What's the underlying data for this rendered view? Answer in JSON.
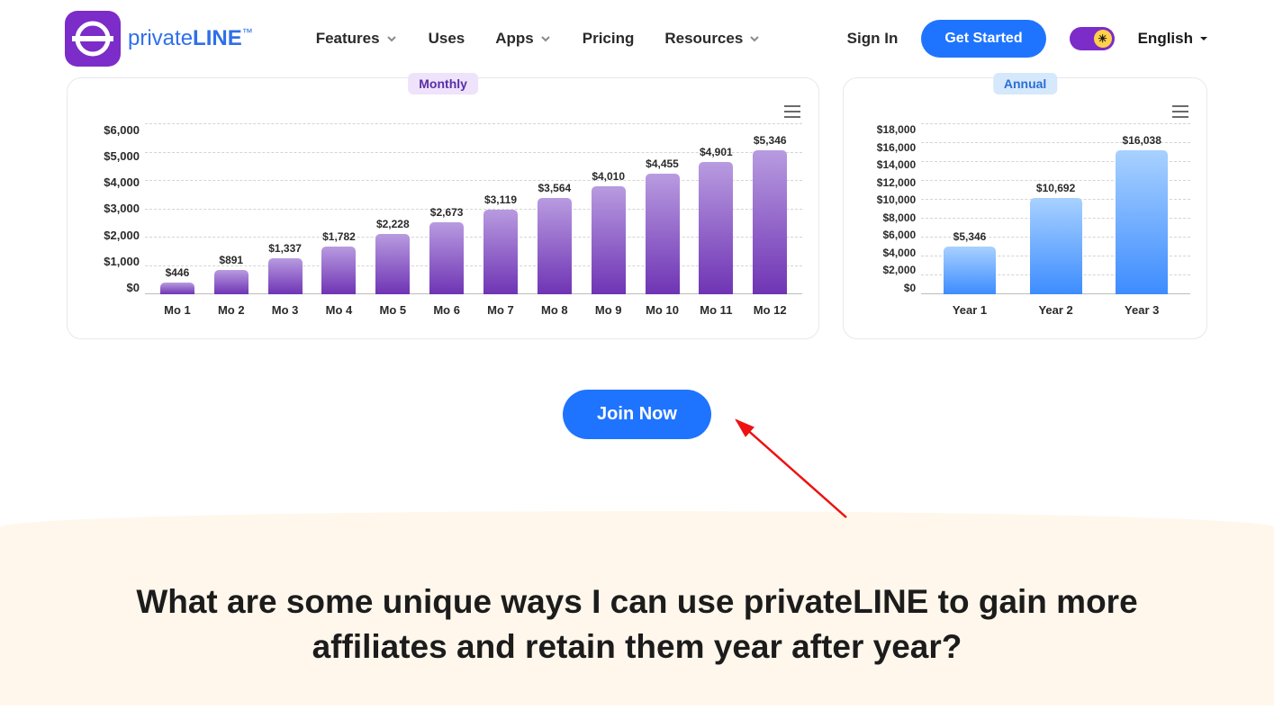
{
  "brand": {
    "private": "private",
    "line": "LINE",
    "tm": "™"
  },
  "nav": {
    "features": "Features",
    "uses": "Uses",
    "apps": "Apps",
    "pricing": "Pricing",
    "resources": "Resources"
  },
  "header": {
    "signin": "Sign In",
    "get_started": "Get Started",
    "language": "English"
  },
  "tabs": {
    "monthly": "Monthly",
    "annual": "Annual"
  },
  "cta": {
    "join": "Join Now"
  },
  "heading": "What are some unique ways I can use privateLINE to gain more affiliates and retain them year after year?",
  "chart_data": [
    {
      "type": "bar",
      "title": "Monthly",
      "categories": [
        "Mo 1",
        "Mo 2",
        "Mo 3",
        "Mo 4",
        "Mo 5",
        "Mo 6",
        "Mo 7",
        "Mo 8",
        "Mo 9",
        "Mo 10",
        "Mo 11",
        "Mo 12"
      ],
      "values": [
        446,
        891,
        1337,
        1782,
        2228,
        2673,
        3119,
        3564,
        4010,
        4455,
        4901,
        5346
      ],
      "value_labels": [
        "$446",
        "$891",
        "$1,337",
        "$1,782",
        "$2,228",
        "$2,673",
        "$3,119",
        "$3,564",
        "$4,010",
        "$4,455",
        "$4,901",
        "$5,346"
      ],
      "ylabel": "",
      "xlabel": "",
      "ylim": [
        0,
        6000
      ],
      "yticks": [
        0,
        1000,
        2000,
        3000,
        4000,
        5000,
        6000
      ],
      "ytick_labels": [
        "$0",
        "$1,000",
        "$2,000",
        "$3,000",
        "$4,000",
        "$5,000",
        "$6,000"
      ],
      "color": "#6f34b4"
    },
    {
      "type": "bar",
      "title": "Annual",
      "categories": [
        "Year 1",
        "Year 2",
        "Year 3"
      ],
      "values": [
        5346,
        10692,
        16038
      ],
      "value_labels": [
        "$5,346",
        "$10,692",
        "$16,038"
      ],
      "ylabel": "",
      "xlabel": "",
      "ylim": [
        0,
        18000
      ],
      "yticks": [
        0,
        2000,
        4000,
        6000,
        8000,
        10000,
        12000,
        14000,
        16000,
        18000
      ],
      "ytick_labels": [
        "$0",
        "$2,000",
        "$4,000",
        "$6,000",
        "$8,000",
        "$10,000",
        "$12,000",
        "$14,000",
        "$16,000",
        "$18,000"
      ],
      "color": "#3d8cff"
    }
  ]
}
